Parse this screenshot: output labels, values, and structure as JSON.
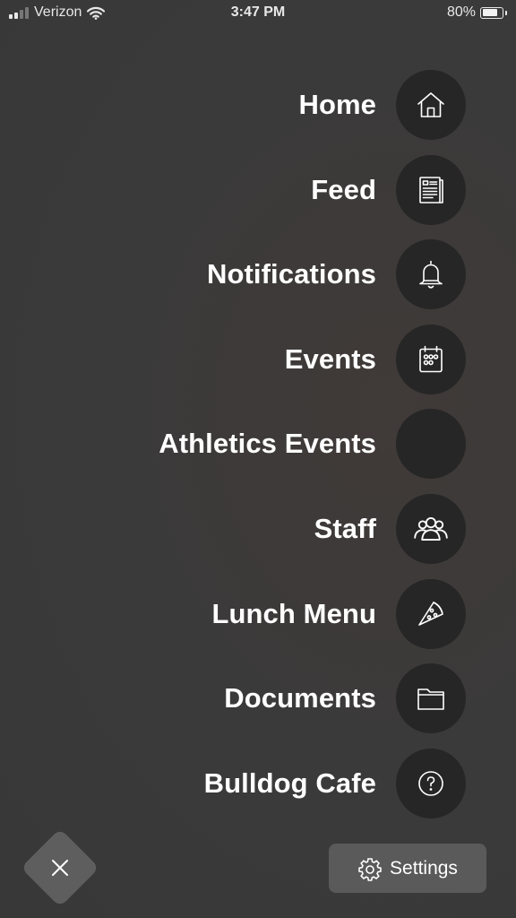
{
  "status_bar": {
    "carrier": "Verizon",
    "time": "3:47 PM",
    "battery_percent": "80%",
    "battery_level": 0.8,
    "icons": [
      "signal-icon",
      "wifi-icon",
      "battery-icon"
    ]
  },
  "menu": {
    "items": [
      {
        "label": "Home",
        "icon": "home-icon"
      },
      {
        "label": "Feed",
        "icon": "newspaper-icon"
      },
      {
        "label": "Notifications",
        "icon": "bell-icon"
      },
      {
        "label": "Events",
        "icon": "calendar-icon"
      },
      {
        "label": "Athletics Events",
        "icon": ""
      },
      {
        "label": "Staff",
        "icon": "people-icon"
      },
      {
        "label": "Lunch Menu",
        "icon": "pizza-icon"
      },
      {
        "label": "Documents",
        "icon": "folder-icon"
      },
      {
        "label": "Bulldog Cafe",
        "icon": "question-icon"
      }
    ]
  },
  "bottom": {
    "close_icon": "close-icon",
    "settings_label": "Settings",
    "settings_icon": "gear-icon"
  },
  "colors": {
    "background": "#3a3a3a",
    "icon_circle": "#262626",
    "button": "#5a5a5a",
    "text": "#ffffff"
  }
}
